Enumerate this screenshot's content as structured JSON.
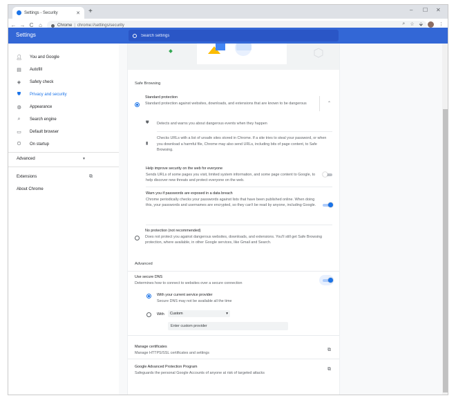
{
  "browser": {
    "tab_title": "Settings - Security",
    "tab_close": "✕",
    "new_tab": "+",
    "window_controls": [
      "–",
      "☐",
      "✕"
    ],
    "nav": {
      "back": "←",
      "forward": "→",
      "reload": "C",
      "home": "⌂"
    },
    "omnibox": {
      "chip": "Chrome",
      "separator": "|",
      "url": "chrome://settings/security"
    },
    "toolbar_icons": {
      "zoom": "⌕",
      "bookmark": "☆",
      "extensions": "⬙",
      "menu": "⋮"
    }
  },
  "header": {
    "title": "Settings",
    "search_placeholder": "Search settings"
  },
  "sidebar": {
    "items": [
      {
        "label": "You and Google",
        "icon": "person-icon"
      },
      {
        "label": "Autofill",
        "icon": "clipboard-icon"
      },
      {
        "label": "Safety check",
        "icon": "shield-check-icon"
      },
      {
        "label": "Privacy and security",
        "icon": "shield-icon"
      },
      {
        "label": "Appearance",
        "icon": "palette-icon"
      },
      {
        "label": "Search engine",
        "icon": "search-icon"
      },
      {
        "label": "Default browser",
        "icon": "browser-icon"
      },
      {
        "label": "On startup",
        "icon": "power-icon"
      }
    ],
    "advanced": "Advanced",
    "extensions": "Extensions",
    "about": "About Chrome"
  },
  "safe_browsing": {
    "section_title": "Safe Browsing",
    "standard": {
      "title": "Standard protection",
      "desc": "Standard protection against websites, downloads, and extensions that are known to be dangerous",
      "selected": true,
      "bullet1": "Detects and warns you about dangerous events when they happen",
      "bullet2": "Checks URLs with a list of unsafe sites stored in Chrome. If a site tries to steal your password, or when you download a harmful file, Chrome may also send URLs, including bits of page content, to Safe Browsing.",
      "help_improve": {
        "title": "Help improve security on the web for everyone",
        "desc": "Sends URLs of some pages you visit, limited system information, and some page content to Google, to help discover new threats and protect everyone on the web.",
        "enabled": false
      },
      "password_warn": {
        "title": "Warn you if passwords are exposed in a data breach",
        "desc": "Chrome periodically checks your passwords against lists that have been published online. When doing this, your passwords and usernames are encrypted, so they can't be read by anyone, including Google.",
        "enabled": true
      }
    },
    "no_protection": {
      "title": "No protection (not recommended)",
      "desc": "Does not protect you against dangerous websites, downloads, and extensions. You'll still get Safe Browsing protection, where available, in other Google services, like Gmail and Search.",
      "selected": false
    }
  },
  "advanced": {
    "section_title": "Advanced",
    "secure_dns": {
      "title": "Use secure DNS",
      "desc": "Determines how to connect to websites over a secure connection",
      "enabled": true,
      "option_current": {
        "title": "With your current service provider",
        "desc": "Secure DNS may not be available all the time",
        "selected": true
      },
      "option_custom": {
        "label": "With",
        "select_value": "Custom",
        "select_arrow": "▾",
        "input_placeholder": "Enter custom provider",
        "selected": false
      }
    },
    "manage_certificates": {
      "title": "Manage certificates",
      "desc": "Manage HTTPS/SSL certificates and settings"
    },
    "advanced_protection": {
      "title": "Google Advanced Protection Program",
      "desc": "Safeguards the personal Google Accounts of anyone at risk of targeted attacks"
    }
  },
  "colors": {
    "header_blue": "#3367d6",
    "accent": "#1a73e8"
  }
}
